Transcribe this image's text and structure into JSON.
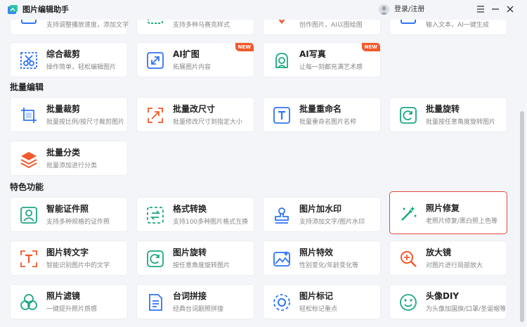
{
  "app": {
    "title": "图片编辑助手",
    "login_label": "登录/注册",
    "window_controls": [
      "menu-icon",
      "minimize-icon",
      "close-icon"
    ]
  },
  "partial_row": [
    {
      "desc": "支持调整播放速度，添加文字",
      "icon": "video-icon"
    },
    {
      "desc": "支持多种马赛克样式",
      "icon": "mosaic-icon"
    },
    {
      "desc": "创作图片，AI以图绘图",
      "icon": "ai-draw-icon"
    },
    {
      "desc": "输入文本，AI一键生成",
      "icon": "text-gen-icon"
    }
  ],
  "top_row": [
    {
      "title": "综合裁剪",
      "desc": "操作简单，轻松编辑图片",
      "icon": "scissors-icon"
    },
    {
      "title": "AI扩图",
      "desc": "拓展图片内容",
      "icon": "expand-icon",
      "badge": "NEW"
    },
    {
      "title": "AI写真",
      "desc": "让每一刻都充满艺术感",
      "icon": "portrait-icon",
      "badge": "NEW"
    }
  ],
  "sections": [
    {
      "title": "批量编辑",
      "items": [
        {
          "title": "批量裁剪",
          "desc": "批量按比例/按尺寸裁剪图片",
          "icon": "batch-crop-icon"
        },
        {
          "title": "批量改尺寸",
          "desc": "批量修改尺寸到指定大小",
          "icon": "resize-icon"
        },
        {
          "title": "批量重命名",
          "desc": "批量重命名图片名称",
          "icon": "rename-icon"
        },
        {
          "title": "批量旋转",
          "desc": "批量按任意角度旋转图片",
          "icon": "batch-rotate-icon"
        },
        {
          "title": "批量分类",
          "desc": "批量添加进行分类",
          "icon": "layers-icon"
        }
      ]
    },
    {
      "title": "特色功能",
      "items": [
        {
          "title": "智能证件照",
          "desc": "支持多种规格的证件照",
          "icon": "id-photo-icon"
        },
        {
          "title": "格式转换",
          "desc": "支持100多种图片格式互换",
          "icon": "convert-icon"
        },
        {
          "title": "图片加水印",
          "desc": "支持添加文字/图片水印",
          "icon": "stamp-icon"
        },
        {
          "title": "照片修复",
          "desc": "老照片修复/黑白照上色等",
          "icon": "magic-wand-icon",
          "active": true
        },
        {
          "title": "图片转文字",
          "desc": "智能识别图片中的文字",
          "icon": "ocr-icon"
        },
        {
          "title": "图片旋转",
          "desc": "按任意角度旋转图片",
          "icon": "rotate-icon"
        },
        {
          "title": "照片特效",
          "desc": "性别变化/年龄变化等",
          "icon": "effects-icon"
        },
        {
          "title": "放大镜",
          "desc": "对图片进行局部放大",
          "icon": "magnifier-icon"
        },
        {
          "title": "照片滤镜",
          "desc": "一键提升照片质感",
          "icon": "filter-icon"
        },
        {
          "title": "台词拼接",
          "desc": "经典台词剧照拼接",
          "icon": "script-icon"
        },
        {
          "title": "图片标记",
          "desc": "轻松标记重点",
          "icon": "marker-icon"
        },
        {
          "title": "头像DIY",
          "desc": "为头像加国旗/口罩/圣诞帽等",
          "icon": "smiley-icon"
        }
      ]
    }
  ],
  "colors": {
    "accent_blue": "#2f74f5",
    "accent_orange": "#f25a2b",
    "accent_teal": "#1ba784",
    "active_border": "#e14a3b",
    "background": "#f3f5f8"
  }
}
